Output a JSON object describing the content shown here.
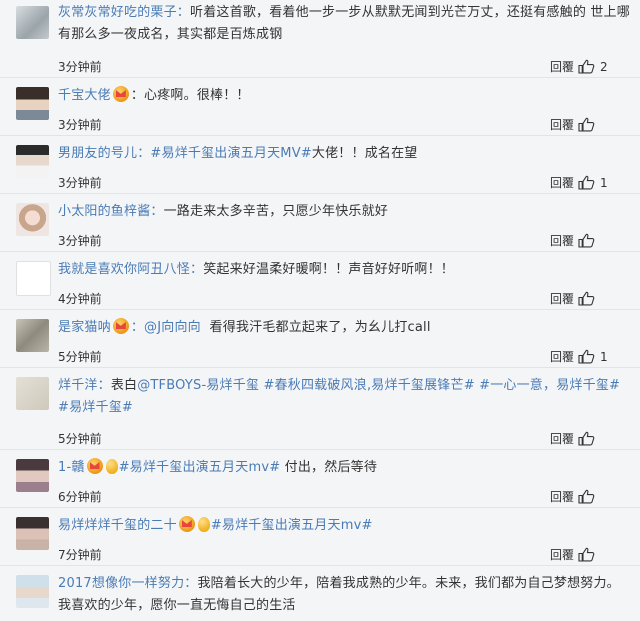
{
  "comments": [
    {
      "user": "灰常灰常好吃的栗子：",
      "text": "听着这首歌，看着他一步一步从默默无闻到光芒万丈，还挺有感触的 世上哪有那么多一夜成名，其实都是百炼成钢",
      "time": "3分钟前",
      "reply": "回覆",
      "likes": "2"
    },
    {
      "user": "千宝大佬",
      "text": "：心疼啊。很棒！！",
      "time": "3分钟前",
      "reply": "回覆",
      "likes": ""
    },
    {
      "user": "男朋友的号儿：",
      "tag": "#易烊千玺出演五月天MV#",
      "text": "大佬！！成名在望",
      "time": "3分钟前",
      "reply": "回覆",
      "likes": "1"
    },
    {
      "user": "小太阳的鱼梓酱：",
      "text": "一路走来太多辛苦，只愿少年快乐就好",
      "time": "3分钟前",
      "reply": "回覆",
      "likes": ""
    },
    {
      "user": "我就是喜欢你阿丑八怪：",
      "text": "笑起来好温柔好暖啊！！声音好好听啊！！",
      "time": "4分钟前",
      "reply": "回覆",
      "likes": ""
    },
    {
      "user": "是家猫呐",
      "mention": "：@J向向向",
      "text": "看得我汗毛都立起来了，为幺儿打call",
      "time": "5分钟前",
      "reply": "回覆",
      "likes": "1"
    },
    {
      "user": "烊千洋：",
      "prefix": "表白",
      "tag": "@TFBOYS-易烊千玺 #春秋四载破风浪,易烊千玺展锋芒# #一心一意，易烊千玺# #易烊千玺#",
      "time": "5分钟前",
      "reply": "回覆",
      "likes": ""
    },
    {
      "user": "1-贛",
      "tag": "#易烊千玺出演五月天mv#",
      "text": "付出，然后等待",
      "time": "6分钟前",
      "reply": "回覆",
      "likes": ""
    },
    {
      "user": "易烊烊烊千玺的二十",
      "tag": "#易烊千玺出演五月天mv#",
      "time": "7分钟前",
      "reply": "回覆",
      "likes": ""
    },
    {
      "user": "2017想像你一样努力：",
      "text": "我陪着长大的少年，陪着我成熟的少年。未来，我们都为自己梦想努力。我喜欢的少年，愿你一直无悔自己的生活",
      "time": "",
      "reply": "",
      "likes": ""
    }
  ],
  "colors": {
    "username": "#4a7bb5",
    "background": "#f4f5f7",
    "divider": "#e3e4e6"
  },
  "icons": {
    "like": "thumbs-up-icon",
    "badge": "crown-badge-icon"
  }
}
